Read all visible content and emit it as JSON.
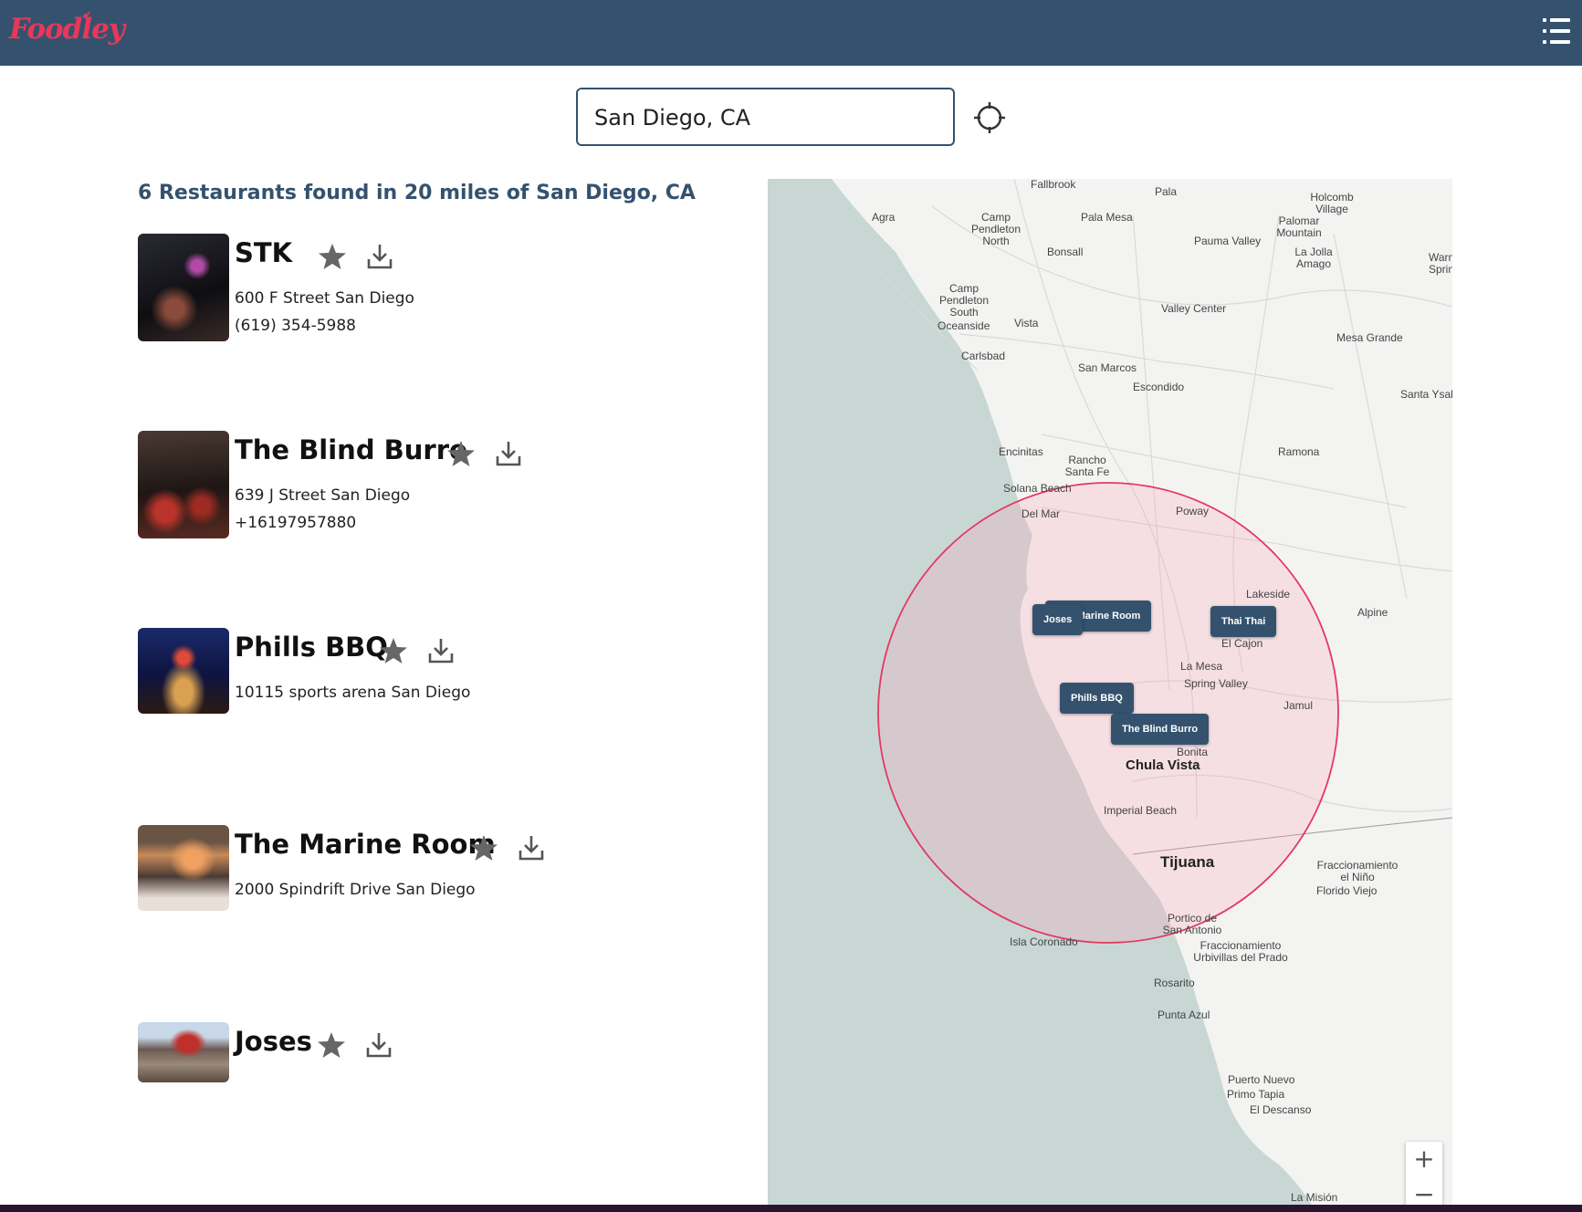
{
  "header": {
    "logo_text": "Foodley",
    "menu_icon": "hamburger-list-icon",
    "colors": {
      "bar": "#34526e",
      "logo": "#e8385a"
    }
  },
  "search": {
    "value": "San Diego, CA",
    "locate_icon": "crosshair-locate-icon"
  },
  "results": {
    "title": "6 Restaurants found in 20 miles of San Diego, CA",
    "items": [
      {
        "name": "STK",
        "address": "600 F Street San Diego",
        "phone": "(619) 354-5988",
        "favorite_icon": "star-icon",
        "download_icon": "download-icon"
      },
      {
        "name": "The Blind Burro",
        "address": "639 J Street San Diego",
        "phone": "+16197957880",
        "favorite_icon": "star-icon",
        "download_icon": "download-icon"
      },
      {
        "name": "Phills BBQ",
        "address": "10115 sports arena San Diego",
        "favorite_icon": "star-icon",
        "download_icon": "download-icon"
      },
      {
        "name": "The Marine Room",
        "address": "2000 Spindrift Drive San Diego",
        "favorite_icon": "star-icon",
        "download_icon": "download-icon"
      },
      {
        "name": "Joses",
        "favorite_icon": "star-icon",
        "download_icon": "download-icon"
      }
    ]
  },
  "map": {
    "markers": [
      "Joses",
      "The Marine Room",
      "Thai Thai",
      "Phills BBQ",
      "The Blind Burro"
    ],
    "places": [
      "Fallbrook",
      "Pala",
      "Holcomb Village",
      "Agra",
      "Camp Pendleton North",
      "Pala Mesa",
      "Palomar Mountain",
      "Bonsall",
      "Pauma Valley",
      "La Jolla Amago",
      "Warner Springs",
      "Camp Pendleton South",
      "Oceanside",
      "Vista",
      "Valley Center",
      "Mesa Grande",
      "Carlsbad",
      "San Marcos",
      "Escondido",
      "Santa Ysabel",
      "Encinitas",
      "Rancho Santa Fe",
      "Ramona",
      "Solana Beach",
      "Del Mar",
      "Poway",
      "Lakeside",
      "Alpine",
      "El Cajon",
      "La Mesa",
      "Spring Valley",
      "Jamul",
      "Bonita",
      "Chula Vista",
      "Imperial Beach",
      "Tijuana",
      "Fraccionamiento el Niño",
      "Florido Viejo",
      "Portico de San Antonio",
      "Fraccionamiento Urbivillas del Prado",
      "Isla Coronado",
      "Rosarito",
      "Punta Azul",
      "Puerto Nuevo",
      "Primo Tapia",
      "El Descanso",
      "La Misión"
    ],
    "radius_miles": 20,
    "zoom_in_label": "+",
    "zoom_out_label": "−",
    "colors": {
      "radius_fill": "#ffd6e0",
      "radius_stroke": "#e23a63",
      "water": "#c9d7d4"
    }
  }
}
